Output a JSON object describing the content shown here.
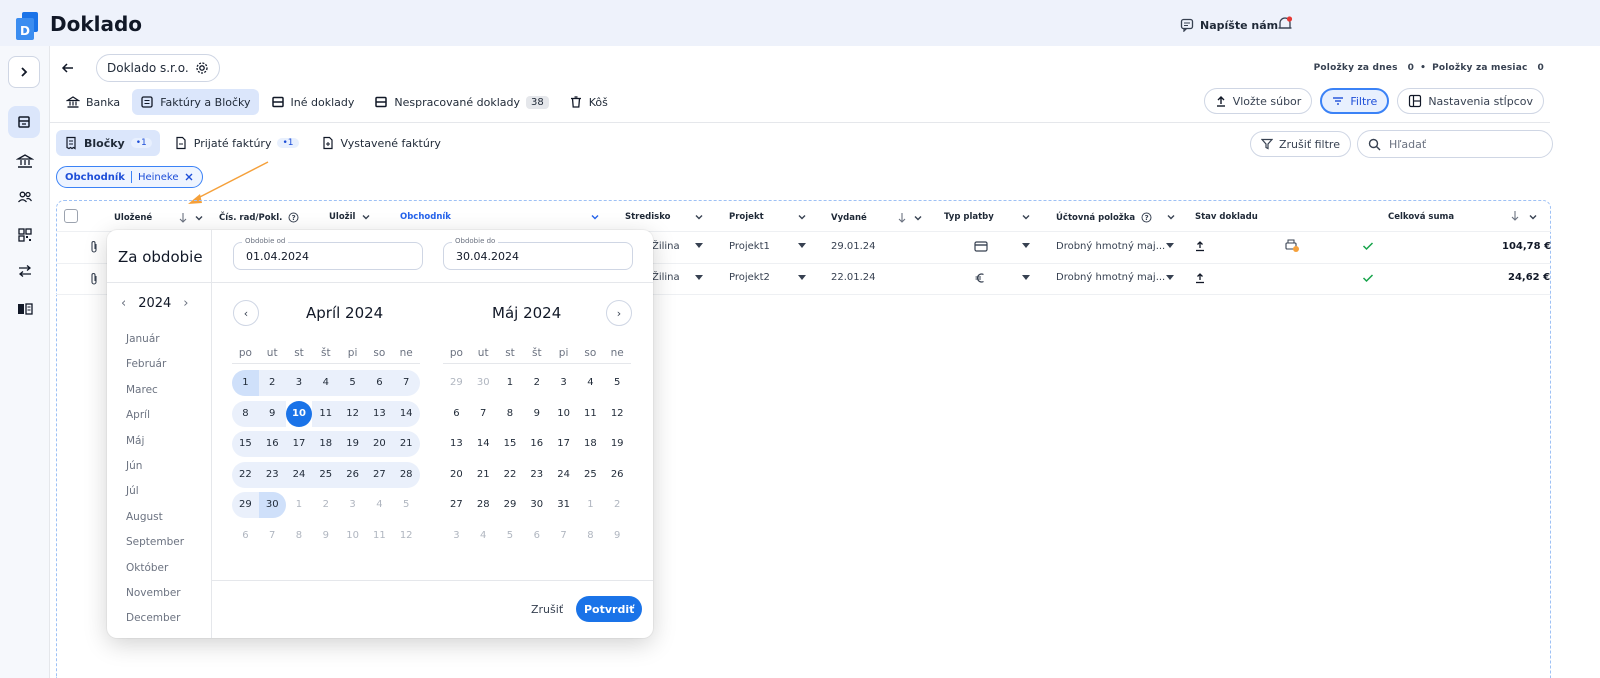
{
  "app": {
    "title": "Doklado",
    "write_us": "Napíšte nám"
  },
  "company": {
    "name": "Doklado s.r.o."
  },
  "stats": {
    "today_label": "Položky za dnes",
    "today_value": "0",
    "month_label": "Položky za mesiac",
    "month_value": "0"
  },
  "nav": {
    "bank": "Banka",
    "invoices": "Faktúry a Bločky",
    "other": "Iné doklady",
    "unprocessed": "Nespracované doklady",
    "unprocessed_count": "38",
    "trash": "Kôš"
  },
  "toolbar": {
    "upload": "Vložte súbor",
    "filters": "Filtre",
    "columns": "Nastavenia stĺpcov"
  },
  "subtabs": {
    "receipts": "Bločky",
    "receipts_badge": "•1",
    "received": "Prijaté faktúry",
    "received_badge": "•1",
    "issued": "Vystavené faktúry"
  },
  "filters": {
    "cancel": "Zrušiť filtre",
    "search_placeholder": "Hľadať"
  },
  "chip": {
    "field": "Obchodník",
    "value": "Heineke"
  },
  "columns": {
    "saved": "Uložené",
    "num": "Čís. rad/Pokl.",
    "saved_by": "Uložil",
    "merchant": "Obchodník",
    "center": "Stredisko",
    "project": "Projekt",
    "issued": "Vydané",
    "payment": "Typ platby",
    "account": "Účtovná položka",
    "status": "Stav dokladu",
    "total": "Celková suma"
  },
  "rows": [
    {
      "center": "Žilina",
      "project": "Projekt1",
      "date": "29.01.24",
      "account": "Drobný hmotný maj...",
      "total": "104,78 €"
    },
    {
      "center": "Žilina",
      "project": "Projekt2",
      "date": "22.01.24",
      "account": "Drobný hmotný maj...",
      "total": "24,62 €"
    }
  ],
  "datepicker": {
    "title": "Za obdobie",
    "year": "2024",
    "months": [
      "Január",
      "Február",
      "Marec",
      "Apríl",
      "Máj",
      "Jún",
      "Júl",
      "August",
      "September",
      "Október",
      "November",
      "December"
    ],
    "from_label": "Obdobie od",
    "from_value": "01.04.2024",
    "to_label": "Obdobie do",
    "to_value": "30.04.2024",
    "left_month": "Apríl 2024",
    "right_month": "Máj 2024",
    "dow": [
      "po",
      "ut",
      "st",
      "št",
      "pi",
      "so",
      "ne"
    ],
    "cancel": "Zrušiť",
    "confirm": "Potvrdiť"
  },
  "colors": {
    "accent": "#1a73e8",
    "range": "#cfe0fa",
    "annotation": "#f5a03a"
  }
}
